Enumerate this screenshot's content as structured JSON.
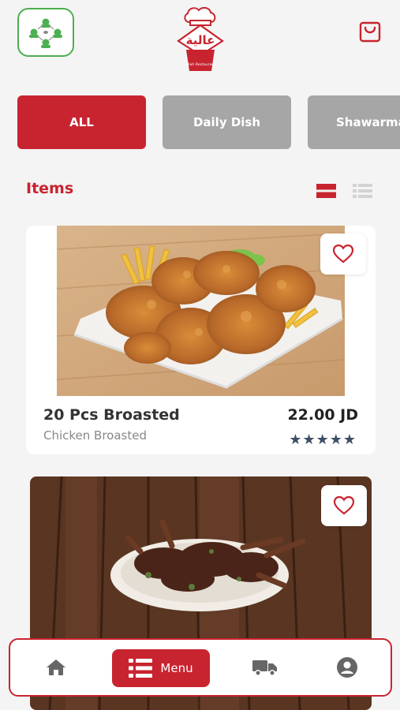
{
  "header": {
    "logo_icon": "people-network-icon",
    "brand_arabic": "عالية",
    "brand_english": "Aliah Restaurant",
    "cart_icon": "shopping-bag-icon"
  },
  "categories": [
    {
      "label": "ALL",
      "active": true
    },
    {
      "label": "Daily Dish",
      "active": false
    },
    {
      "label": "Shawarma",
      "active": false
    }
  ],
  "section": {
    "title": "Items",
    "list_view_icon": "list-view-icon",
    "grid_view_icon": "grid-view-icon"
  },
  "items": [
    {
      "name": "20 Pcs Broasted",
      "subtitle": "Chicken Broasted",
      "price": "22.00 JD",
      "rating": 5,
      "stars": "★★★★★",
      "favorite_icon": "heart-outline-icon"
    },
    {
      "name": "",
      "favorite_icon": "heart-outline-icon"
    }
  ],
  "bottom_nav": {
    "home_icon": "home-icon",
    "menu_label": "Menu",
    "menu_icon": "list-icon",
    "delivery_icon": "truck-icon",
    "profile_icon": "user-circle-icon"
  },
  "colors": {
    "accent": "#c8242f",
    "inactive_tab": "#a6a6a6",
    "star": "#3d4e66",
    "logo_border": "#4caf50"
  }
}
